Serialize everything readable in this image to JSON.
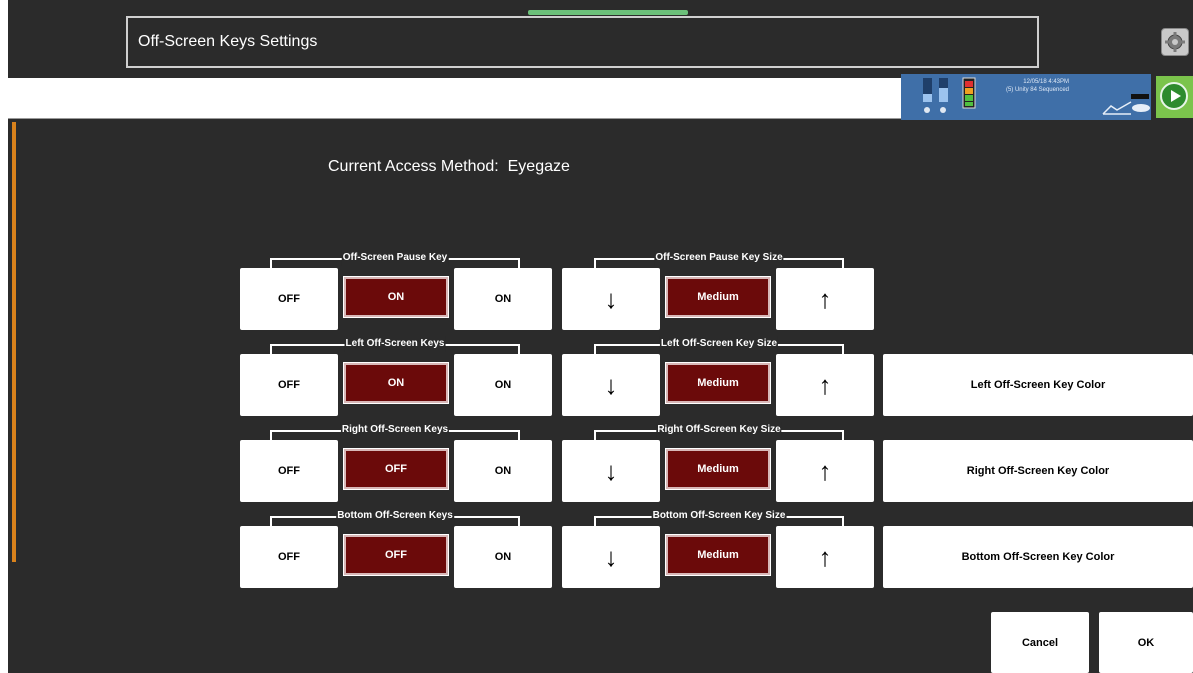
{
  "window": {
    "title": "Off-Screen Keys Settings"
  },
  "status": {
    "datetime": "12/05/18 4:43PM",
    "vocabulary": "(5) Unity 84 Sequenced",
    "accent": "#3f6fa8"
  },
  "access_method": {
    "text": "Current Access Method:  Eyegaze"
  },
  "rows": [
    {
      "toggle_label": "Off-Screen Pause Key",
      "size_label": "Off-Screen Pause Key Size",
      "off_label": "OFF",
      "state_label": "ON",
      "on_label": "ON",
      "down_glyph": "↓",
      "size_value": "Medium",
      "up_glyph": "↑",
      "color_label": null
    },
    {
      "toggle_label": "Left Off-Screen Keys",
      "size_label": "Left Off-Screen Key Size",
      "off_label": "OFF",
      "state_label": "ON",
      "on_label": "ON",
      "down_glyph": "↓",
      "size_value": "Medium",
      "up_glyph": "↑",
      "color_label": "Left Off-Screen Key Color"
    },
    {
      "toggle_label": "Right Off-Screen Keys",
      "size_label": "Right Off-Screen Key Size",
      "off_label": "OFF",
      "state_label": "OFF",
      "on_label": "ON",
      "down_glyph": "↓",
      "size_value": "Medium",
      "up_glyph": "↑",
      "color_label": "Right Off-Screen Key Color"
    },
    {
      "toggle_label": "Bottom Off-Screen Keys",
      "size_label": "Bottom Off-Screen Key Size",
      "off_label": "OFF",
      "state_label": "OFF",
      "on_label": "ON",
      "down_glyph": "↓",
      "size_value": "Medium",
      "up_glyph": "↑",
      "color_label": "Bottom Off-Screen Key Color"
    }
  ],
  "footer": {
    "cancel_label": "Cancel",
    "ok_label": "OK"
  },
  "icons": {
    "gear": "gear-icon",
    "play": "play-icon",
    "battery": "battery-icon",
    "volume": "volume-icon"
  },
  "colors": {
    "background": "#2b2b2b",
    "selected": "#6b0a0a",
    "play": "#7bc44c",
    "side_strip": "#d9821c"
  }
}
